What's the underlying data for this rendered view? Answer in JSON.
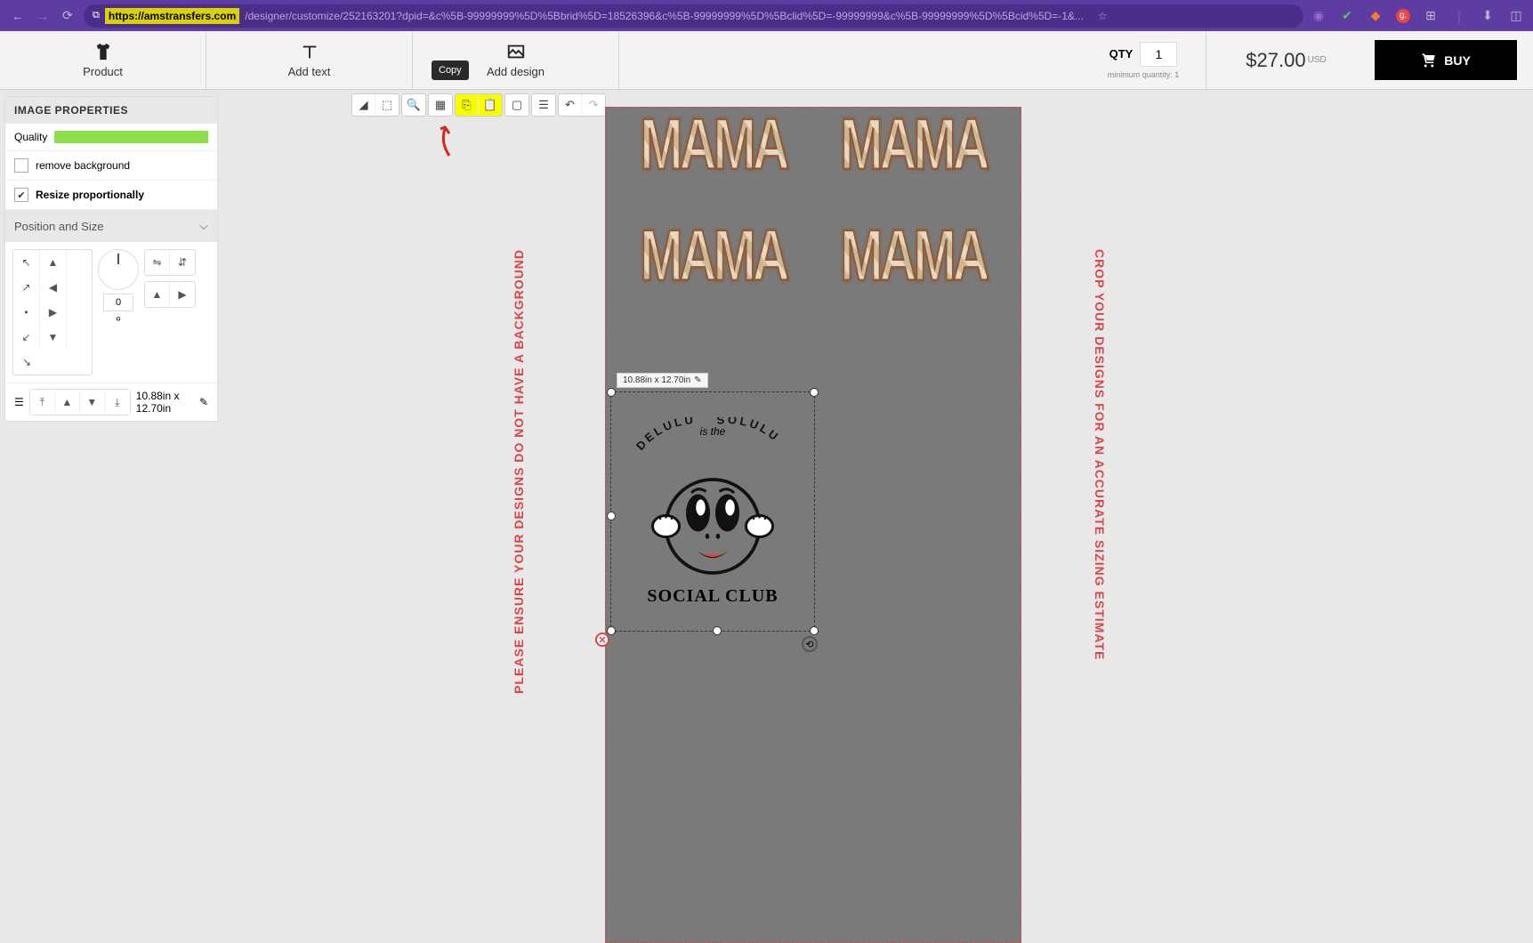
{
  "browser": {
    "url_secure_part": "https://amstransfers.com",
    "url_rest": "/designer/customize/252163201?dpid=&c%5B-99999999%5D%5Bbrid%5D=18526396&c%5B-99999999%5D%5Bclid%5D=-99999999&c%5B-99999999%5D%5Bcid%5D=-1&...",
    "star": "☆"
  },
  "tools": {
    "product": "Product",
    "add_text": "Add text",
    "add_design": "Add design"
  },
  "qty": {
    "label": "QTY",
    "value": "1",
    "min": "minimum quantity: 1"
  },
  "price": {
    "amount": "$27.00",
    "currency": "USD"
  },
  "buy": "BUY",
  "sidebar": {
    "title": "IMAGE PROPERTIES",
    "quality": "Quality",
    "remove_bg": "remove background",
    "resize_prop": "Resize proportionally",
    "position_size": "Position and Size",
    "rotation": "0",
    "dimensions": "10.88in x 12.70in"
  },
  "tooltip": {
    "copy": "Copy"
  },
  "canvas": {
    "left_text": "PLEASE ENSURE YOUR DESIGNS DO NOT HAVE A BACKGROUND",
    "right_text": "CROP YOUR DESIGNS FOR AN ACCURATE SIZING ESTIMATE",
    "mama": "MAMA",
    "selection_size": "10.88in x 12.70in",
    "design": {
      "top_arc": "DELULU",
      "is_the": "is the",
      "top_arc2": "SOLULU",
      "bottom": "SOCIAL CLUB"
    }
  }
}
